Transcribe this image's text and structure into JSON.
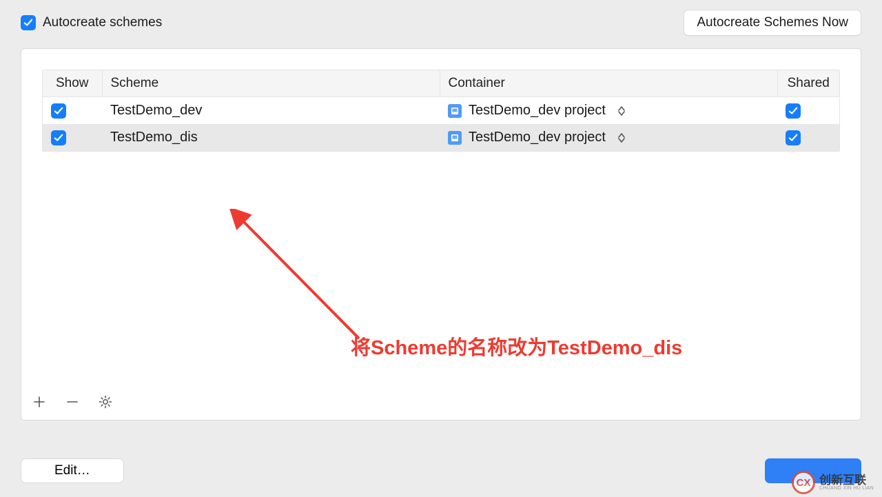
{
  "topbar": {
    "autocreate_label": "Autocreate schemes",
    "autocreate_checked": true,
    "autocreate_now_button": "Autocreate Schemes Now"
  },
  "table": {
    "headers": {
      "show": "Show",
      "scheme": "Scheme",
      "container": "Container",
      "shared": "Shared"
    },
    "rows": [
      {
        "show_checked": true,
        "scheme": "TestDemo_dev",
        "container": "TestDemo_dev project",
        "shared_checked": true,
        "selected": false
      },
      {
        "show_checked": true,
        "scheme": "TestDemo_dis",
        "container": "TestDemo_dev project",
        "shared_checked": true,
        "selected": true
      }
    ]
  },
  "annotation": {
    "text": "将Scheme的名称改为TestDemo_dis",
    "color": "#ee3a30"
  },
  "bottom": {
    "edit_label": "Edit…"
  },
  "watermark": {
    "cn": "创新互联",
    "en": "CHUANG XIN HU LIAN"
  }
}
